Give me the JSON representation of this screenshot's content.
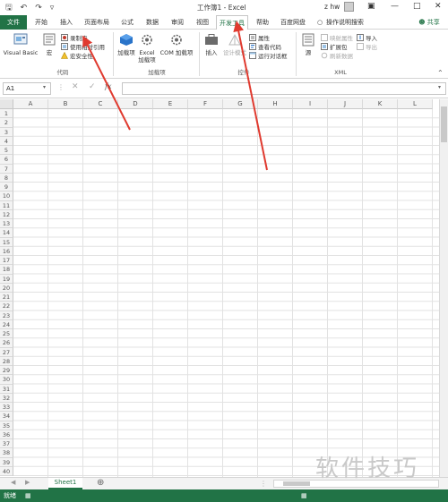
{
  "titlebar": {
    "title": "工作簿1 - Excel",
    "user": "z hw"
  },
  "tabs": [
    {
      "label": "文件"
    },
    {
      "label": "开始"
    },
    {
      "label": "插入"
    },
    {
      "label": "页面布局"
    },
    {
      "label": "公式"
    },
    {
      "label": "数据"
    },
    {
      "label": "审阅"
    },
    {
      "label": "视图"
    },
    {
      "label": "开发工具"
    },
    {
      "label": "帮助"
    },
    {
      "label": "百度网盘"
    },
    {
      "label": "操作说明搜索"
    }
  ],
  "share_label": "共享",
  "ribbon": {
    "code": {
      "group_label": "代码",
      "visual_basic": "Visual Basic",
      "macros": "宏",
      "record_macro": "录制宏",
      "relative_ref": "使用相对引用",
      "macro_security": "宏安全性"
    },
    "addins": {
      "group_label": "加载项",
      "addins_btn": "加载项",
      "excel_addins": "Excel 加载项",
      "com_addins": "COM 加载项"
    },
    "controls": {
      "group_label": "控件",
      "insert": "插入",
      "design_mode": "设计模式",
      "properties": "属性",
      "view_code": "查看代码",
      "run_dialog": "运行对话框"
    },
    "xml": {
      "group_label": "XML",
      "source": "源",
      "map_properties": "映射属性",
      "expansion_packs": "扩展包",
      "refresh_data": "刷新数据",
      "import": "导入",
      "export": "导出"
    }
  },
  "formula_bar": {
    "name_box": "A1",
    "fx": "fx",
    "value": ""
  },
  "columns": [
    "A",
    "B",
    "C",
    "D",
    "E",
    "F",
    "G",
    "H",
    "I",
    "J",
    "K",
    "L"
  ],
  "rows": [
    "1",
    "2",
    "3",
    "4",
    "5",
    "6",
    "7",
    "8",
    "9",
    "10",
    "11",
    "12",
    "13",
    "14",
    "15",
    "16",
    "17",
    "18",
    "19",
    "20",
    "21",
    "22",
    "23",
    "24",
    "25",
    "26",
    "27",
    "28",
    "29",
    "30",
    "31",
    "32",
    "33",
    "34",
    "35",
    "36",
    "37",
    "38",
    "39",
    "40"
  ],
  "sheet_tab": "Sheet1",
  "status": {
    "ready": "就绪"
  },
  "watermark": "软件技巧",
  "accent_color": "#217346",
  "arrow_color": "#e03a2f"
}
